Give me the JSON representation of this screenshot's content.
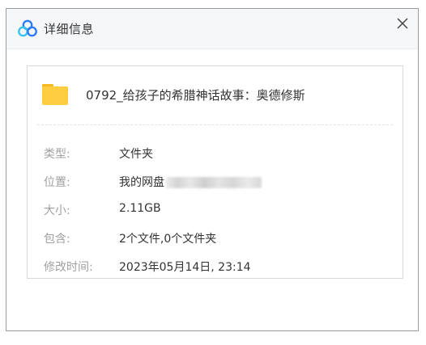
{
  "window": {
    "title": "详细信息"
  },
  "file": {
    "name": "0792_给孩子的希腊神话故事：奥德修斯"
  },
  "props": {
    "type": {
      "label": "类型:",
      "value": "文件夹"
    },
    "location": {
      "label": "位置:",
      "value": "我的网盘"
    },
    "size": {
      "label": "大小:",
      "value": "2.11GB"
    },
    "contains": {
      "label": "包含:",
      "value": "2个文件,0个文件夹"
    },
    "modified": {
      "label": "修改时间:",
      "value": "2023年05月14日, 23:14"
    }
  },
  "icons": {
    "app_logo": "baidu-netdisk-logo-icon",
    "close": "close-icon",
    "folder": "folder-icon"
  },
  "colors": {
    "logo_blue": "#2f7bf5",
    "logo_cyan": "#35c3f0",
    "folder_yellow": "#ffcd3f",
    "label_gray": "#a0a0a0",
    "text_dark": "#333333"
  }
}
